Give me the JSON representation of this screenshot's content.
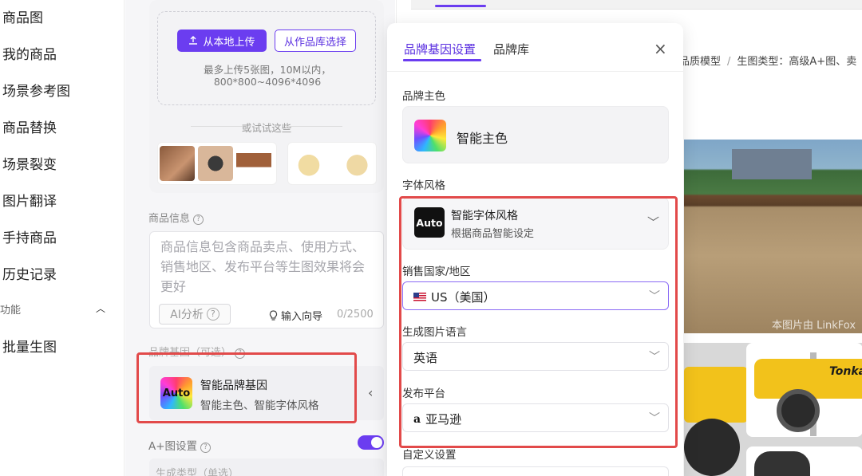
{
  "nav": {
    "items": [
      "商品图",
      "我的商品",
      "场景参考图",
      "商品替换",
      "场景裂变",
      "图片翻译",
      "手持商品",
      "历史记录"
    ],
    "section": "功能",
    "section_items": [
      "批量生图"
    ]
  },
  "upload": {
    "upload_button": "从本地上传",
    "library_button": "从作品库选择",
    "hint_line1": "最多上传5张图，10M以内，",
    "hint_line2": "800*800~4096*4096",
    "try_text": "或试试这些"
  },
  "product_info": {
    "label": "商品信息",
    "placeholder": "商品信息包含商品卖点、使用方式、销售地区、发布平台等生图效果将会更好",
    "ai_button": "AI分析",
    "guide": "输入向导",
    "count": "0/2500"
  },
  "brand_dna": {
    "label": "品牌基因（可选）",
    "logo": "Auto",
    "title": "智能品牌基因",
    "subtitle": "智能主色、智能字体风格"
  },
  "aplus": {
    "label": "A+图设置",
    "gen_type_label": "生成类型（单选）"
  },
  "breadcrumb": {
    "part1": "品质模型",
    "part2": "生图类型：高级A+图、卖"
  },
  "preview": {
    "caption": "本图片由 LinkFox",
    "truck_text": "Tonka"
  },
  "modal": {
    "tab_active": "品牌基因设置",
    "tab_other": "品牌库",
    "close": "×",
    "color_label": "品牌主色",
    "color_value": "智能主色",
    "font_label": "字体风格",
    "font_logo": "Auto",
    "font_title": "智能字体风格",
    "font_sub": "根据商品智能设定",
    "country_label": "销售国家/地区",
    "country_value": "US（美国）",
    "lang_label": "生成图片语言",
    "lang_value": "英语",
    "platform_label": "发布平台",
    "platform_icon": "a",
    "platform_value": "亚马逊",
    "custom_label": "自定义设置"
  },
  "colors": {
    "accent": "#6b3df0",
    "highlight": "#e24a4a"
  }
}
